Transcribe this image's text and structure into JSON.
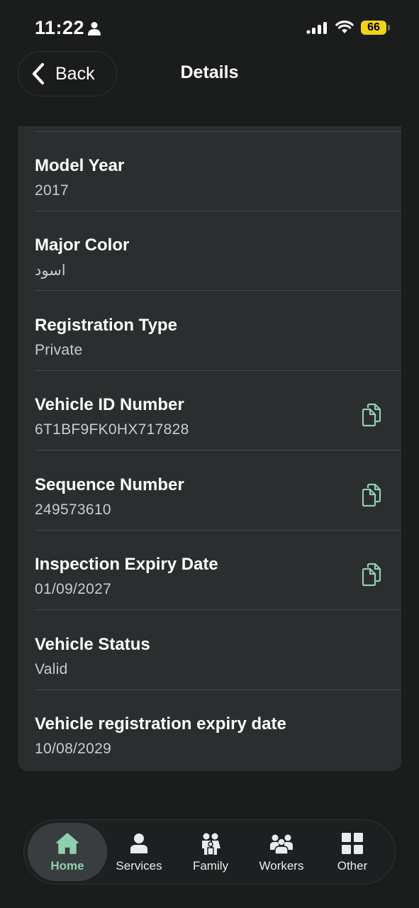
{
  "status_bar": {
    "time": "11:22",
    "battery": "66"
  },
  "header": {
    "back_label": "Back",
    "title": "Details"
  },
  "details": [
    {
      "label": "Model Year",
      "value": "2017",
      "copy": false
    },
    {
      "label": "Major Color",
      "value": "اسود",
      "copy": false
    },
    {
      "label": "Registration Type",
      "value": "Private",
      "copy": false
    },
    {
      "label": "Vehicle ID Number",
      "value": "6T1BF9FK0HX717828",
      "copy": true
    },
    {
      "label": "Sequence Number",
      "value": "249573610",
      "copy": true
    },
    {
      "label": "Inspection Expiry Date",
      "value": "01/09/2027",
      "copy": true
    },
    {
      "label": "Vehicle Status",
      "value": "Valid",
      "copy": false
    },
    {
      "label": "Vehicle registration expiry date",
      "value": "10/08/2029",
      "copy": false
    }
  ],
  "tabs": [
    {
      "label": "Home",
      "icon": "home-icon",
      "active": true
    },
    {
      "label": "Services",
      "icon": "person-icon",
      "active": false
    },
    {
      "label": "Family",
      "icon": "family-icon",
      "active": false
    },
    {
      "label": "Workers",
      "icon": "workers-icon",
      "active": false
    },
    {
      "label": "Other",
      "icon": "grid-icon",
      "active": false
    }
  ],
  "colors": {
    "accent": "#8fd0b0",
    "card": "#2b2e2f",
    "background": "#1b1c1c",
    "battery": "#f2d21b"
  }
}
